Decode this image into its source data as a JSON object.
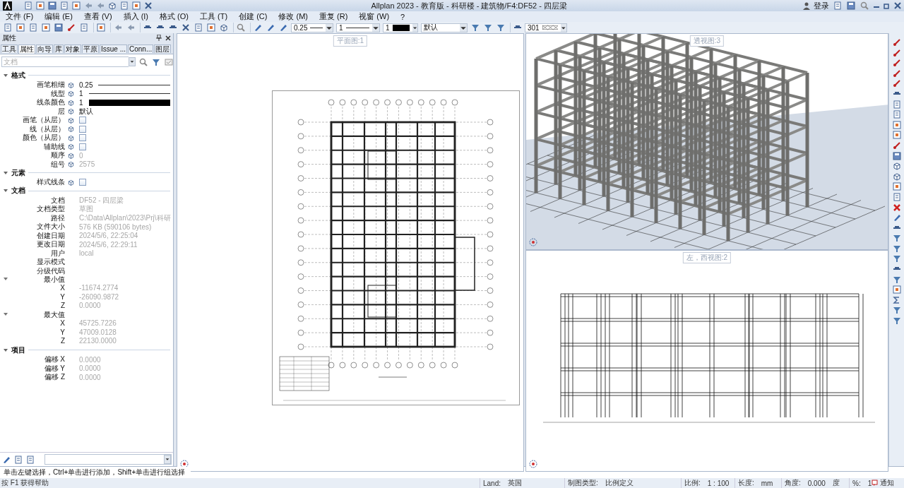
{
  "window": {
    "title": "Allplan 2023 - 教育版 - 科研楼 - 建筑物/F4:DF52 - 四层梁",
    "login": "登录"
  },
  "menu": [
    "文件 (F)",
    "编辑 (E)",
    "查看 (V)",
    "插入 (I)",
    "格式 (O)",
    "工具 (T)",
    "创建 (C)",
    "修改 (M)",
    "重复 (R)",
    "视窗 (W)",
    "?"
  ],
  "toolbar": {
    "pen": "0.25",
    "line": "1",
    "color_index": "1",
    "layer": "默认",
    "hatch": "301"
  },
  "panel": {
    "title": "属性",
    "tabs": [
      {
        "label": "工具",
        "selected": false
      },
      {
        "label": "属性",
        "selected": true
      },
      {
        "label": "向导",
        "selected": false
      },
      {
        "label": "库",
        "selected": false
      },
      {
        "label": "对象",
        "selected": false
      },
      {
        "label": "平原",
        "selected": false
      },
      {
        "label": "Issue ...",
        "selected": false
      },
      {
        "label": "Conn...",
        "selected": false
      },
      {
        "label": "图层",
        "selected": false
      }
    ],
    "filter": {
      "placeholder": "文档"
    },
    "sections": [
      {
        "title": "格式",
        "expanded": true,
        "rows": [
          {
            "label": "画笔粗细",
            "kind": "line",
            "value": "0.25",
            "icon": true,
            "disabled": false
          },
          {
            "label": "线型",
            "kind": "line",
            "value": "1",
            "icon": true,
            "disabled": false
          },
          {
            "label": "线条颜色",
            "kind": "color",
            "value": "1",
            "icon": true,
            "disabled": false
          },
          {
            "label": "层",
            "kind": "text",
            "value": "默认",
            "icon": true,
            "disabled": false
          },
          {
            "label": "画笔（从层）",
            "kind": "checkbox",
            "checked": false,
            "icon": true
          },
          {
            "label": "线（从层）",
            "kind": "checkbox",
            "checked": false,
            "icon": true
          },
          {
            "label": "颜色（从层）",
            "kind": "checkbox",
            "checked": false,
            "icon": true
          },
          {
            "label": "辅助线",
            "kind": "checkbox",
            "checked": false,
            "icon": true
          },
          {
            "label": "顺序",
            "kind": "text",
            "value": "0",
            "icon": true,
            "disabled": true
          },
          {
            "label": "组号",
            "kind": "text",
            "value": "2575",
            "icon": true,
            "disabled": true
          }
        ]
      },
      {
        "title": "元素",
        "expanded": true,
        "rows": [
          {
            "label": "样式线条",
            "kind": "checkbox",
            "checked": false,
            "icon": true
          }
        ]
      },
      {
        "title": "文档",
        "expanded": true,
        "rows": [
          {
            "label": "文档",
            "kind": "text",
            "value": "DF52 - 四层梁",
            "icon": false,
            "disabled": true
          },
          {
            "label": "文档类型",
            "kind": "text",
            "value": "草图",
            "icon": false,
            "disabled": true
          },
          {
            "label": "路径",
            "kind": "text",
            "value": "C:\\Data\\Allplan\\2023\\Prj\\科研",
            "icon": false,
            "disabled": true
          },
          {
            "label": "文件大小",
            "kind": "text",
            "value": "576 KB (590106 bytes)",
            "icon": false,
            "disabled": true
          },
          {
            "label": "创建日期",
            "kind": "text",
            "value": "2024/5/6, 22:25:04",
            "icon": false,
            "disabled": true
          },
          {
            "label": "更改日期",
            "kind": "text",
            "value": "2024/5/6, 22:29:11",
            "icon": false,
            "disabled": true
          },
          {
            "label": "用户",
            "kind": "text",
            "value": "local",
            "icon": false,
            "disabled": true
          },
          {
            "label": "显示模式",
            "kind": "text",
            "icon": false
          },
          {
            "label": "分级代码",
            "kind": "text",
            "icon": false
          },
          {
            "label": "最小值",
            "kind": "group",
            "expanded": true,
            "children": [
              {
                "label": "X",
                "kind": "text",
                "value": "-11674.2774",
                "icon": false,
                "disabled": true
              },
              {
                "label": "Y",
                "kind": "text",
                "value": "-26090.9872",
                "icon": false,
                "disabled": true
              },
              {
                "label": "Z",
                "kind": "text",
                "value": "0.0000",
                "icon": false,
                "disabled": true
              }
            ]
          },
          {
            "label": "最大值",
            "kind": "group",
            "expanded": true,
            "children": [
              {
                "label": "X",
                "kind": "text",
                "value": "45725.7226",
                "icon": false,
                "disabled": true
              },
              {
                "label": "Y",
                "kind": "text",
                "value": "47009.0128",
                "icon": false,
                "disabled": true
              },
              {
                "label": "Z",
                "kind": "text",
                "value": "22130.0000",
                "icon": false,
                "disabled": true
              }
            ]
          }
        ]
      },
      {
        "title": "项目",
        "expanded": true,
        "rows": [
          {
            "label": "偏移 X",
            "kind": "text",
            "value": "0.0000",
            "icon": false,
            "disabled": true
          },
          {
            "label": "偏移 Y",
            "kind": "text",
            "value": "0.0000",
            "icon": false,
            "disabled": true
          },
          {
            "label": "偏移 Z",
            "kind": "text",
            "value": "0.0000",
            "icon": false,
            "disabled": true
          }
        ]
      }
    ]
  },
  "viewports": [
    {
      "title": "平面图:1",
      "kind": "plan"
    },
    {
      "title": "透视图:3",
      "kind": "perspective"
    },
    {
      "title": "左，西视图:2",
      "kind": "elevation"
    }
  ],
  "hint": "单击左键选择，Ctrl+单击进行添加，Shift+单击进行组选择",
  "status": {
    "help": "按 F1 获得帮助",
    "items": [
      {
        "label": "Land:",
        "value": "英国"
      },
      {
        "label": "制图类型:",
        "value": "比例定义"
      },
      {
        "label": "比例:",
        "value": "1 : 100"
      },
      {
        "label": "长度:",
        "value": "mm"
      },
      {
        "label": "角度:",
        "value": "0.000",
        "unit": "度"
      },
      {
        "label": "%:",
        "value": "1"
      }
    ],
    "notice": "通知"
  }
}
